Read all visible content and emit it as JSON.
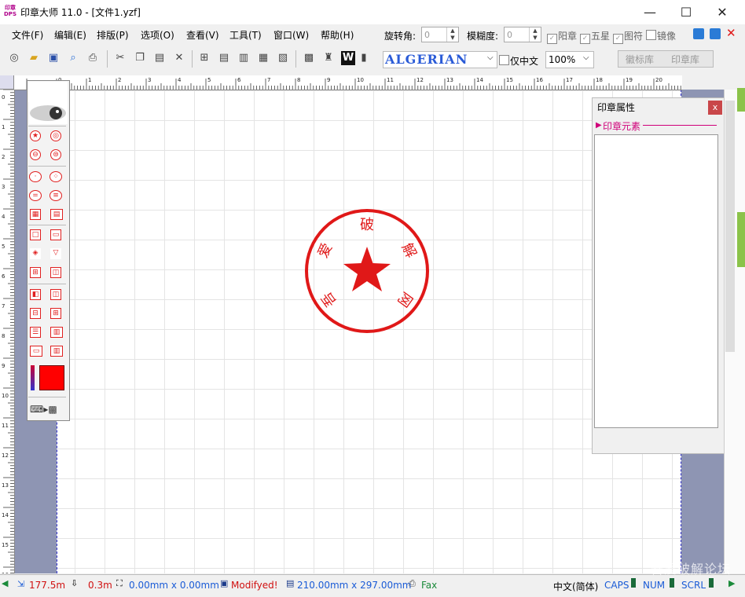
{
  "window": {
    "logo_text": "印章 DPS",
    "title": "印章大师 11.0 - [文件1.yzf]",
    "controls": [
      "—",
      "☐",
      "✕"
    ]
  },
  "menu": [
    "文件(F)",
    "编辑(E)",
    "排版(P)",
    "选项(O)",
    "查看(V)",
    "工具(T)",
    "窗口(W)",
    "帮助(H)"
  ],
  "props_toolbar": {
    "rotation_label": "旋转角:",
    "rotation_value": "0",
    "blur_label": "模糊度:",
    "blur_value": "0",
    "checkboxes": [
      {
        "label": "阳章",
        "checked": true
      },
      {
        "label": "五星",
        "checked": true
      },
      {
        "label": "图符",
        "checked": true
      },
      {
        "label": "镜像",
        "checked": false
      }
    ]
  },
  "font": {
    "name": "ALGERIAN",
    "only_chinese_label": "仅中文",
    "zoom": "100%"
  },
  "library_tabs": [
    "徽标库",
    "印章库"
  ],
  "seal": {
    "text_chars": [
      "吾",
      "爱",
      "破",
      "解",
      "网"
    ],
    "color": "#e01818"
  },
  "panel": {
    "title": "印章属性",
    "close": "x",
    "section": "印章元素"
  },
  "status": {
    "length": "177.5m",
    "thickness": "0.3m",
    "selection_size": "0.00mm x 0.00mm",
    "modified": "Modifyed!",
    "page_size": "210.00mm x 297.00mm",
    "fax": "Fax",
    "ime": "中文(简体)",
    "caps": "CAPS",
    "num": "NUM",
    "scrl": "SCRL"
  },
  "watermark": "吾爱破解论坛",
  "colors": {
    "accent_red": "#e01818",
    "magenta": "#d0007a",
    "canvas_bg": "#8e95b3",
    "font_blue": "#2a5bd7"
  }
}
